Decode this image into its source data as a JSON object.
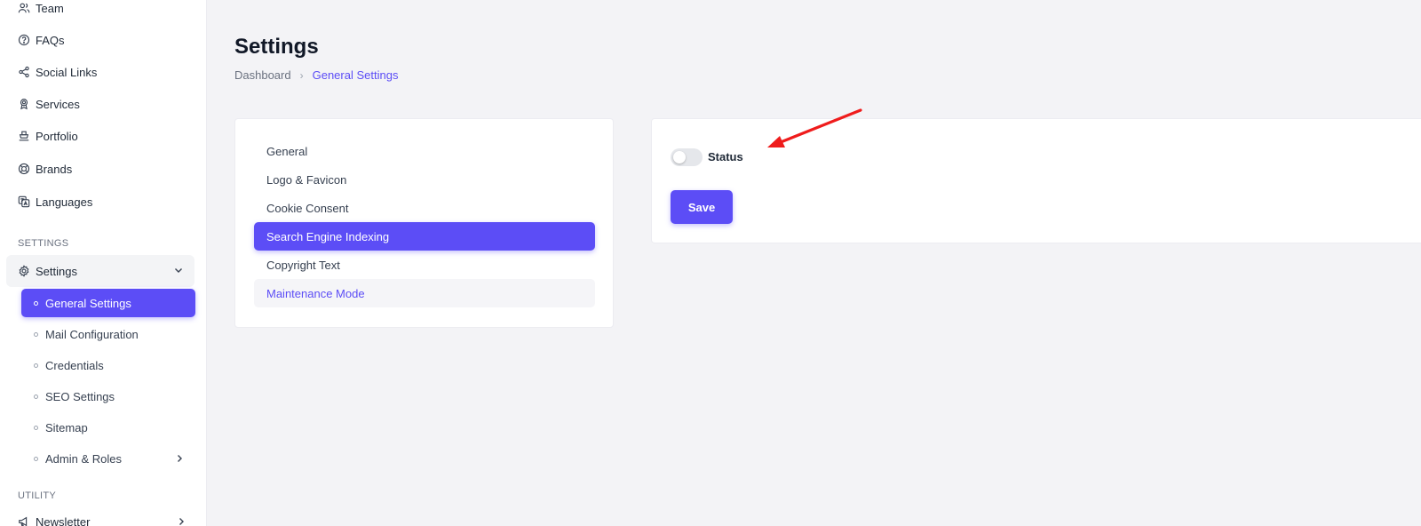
{
  "sidebar": {
    "items": [
      {
        "label": "Team",
        "icon": "users-icon"
      },
      {
        "label": "FAQs",
        "icon": "question-circle-icon"
      },
      {
        "label": "Social Links",
        "icon": "share-icon"
      },
      {
        "label": "Services",
        "icon": "award-icon"
      },
      {
        "label": "Portfolio",
        "icon": "briefcase-icon"
      },
      {
        "label": "Brands",
        "icon": "lifebuoy-icon"
      },
      {
        "label": "Languages",
        "icon": "translate-icon"
      }
    ],
    "settings_section": "SETTINGS",
    "settings_parent": {
      "label": "Settings",
      "icon": "gear-icon"
    },
    "sub_items": [
      {
        "label": "General Settings"
      },
      {
        "label": "Mail Configuration"
      },
      {
        "label": "Credentials"
      },
      {
        "label": "SEO Settings"
      },
      {
        "label": "Sitemap"
      },
      {
        "label": "Admin & Roles"
      }
    ],
    "utility_section": "UTILITY",
    "newsletter": {
      "label": "Newsletter",
      "icon": "megaphone-icon"
    }
  },
  "page": {
    "title": "Settings",
    "breadcrumb": {
      "home": "Dashboard",
      "separator": "›",
      "current": "General Settings"
    }
  },
  "tabs": [
    {
      "label": "General"
    },
    {
      "label": "Logo & Favicon"
    },
    {
      "label": "Cookie Consent"
    },
    {
      "label": "Search Engine Indexing"
    },
    {
      "label": "Copyright Text"
    },
    {
      "label": "Maintenance Mode"
    }
  ],
  "form": {
    "status_label": "Status",
    "status_on": false,
    "save_label": "Save"
  },
  "colors": {
    "accent": "#5c4df6",
    "annotation_arrow": "#ef1c1c"
  }
}
